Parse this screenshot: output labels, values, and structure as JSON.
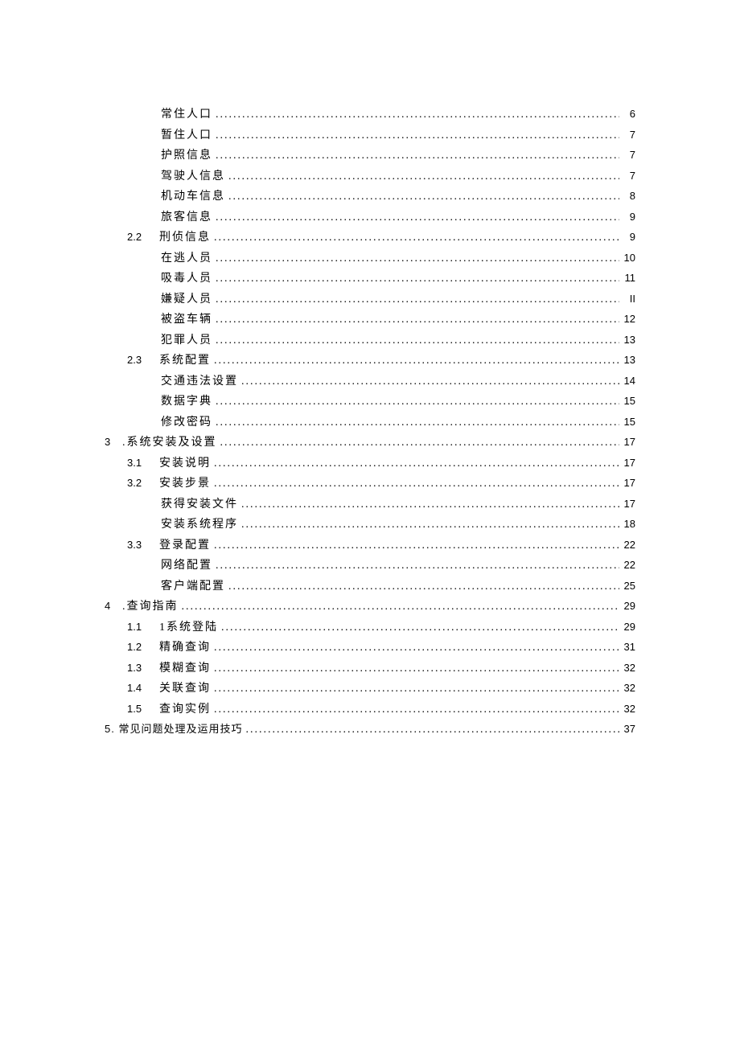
{
  "toc": [
    {
      "level": 2,
      "num": "",
      "title": "常住人口",
      "page": "6"
    },
    {
      "level": 2,
      "num": "",
      "title": "暂住人口",
      "page": "7"
    },
    {
      "level": 2,
      "num": "",
      "title": "护照信息",
      "page": "7"
    },
    {
      "level": 2,
      "num": "",
      "title": "驾驶人信息",
      "page": "7"
    },
    {
      "level": 2,
      "num": "",
      "title": "机动车信息",
      "page": "8"
    },
    {
      "level": 2,
      "num": "",
      "title": "旅客信息",
      "page": "9"
    },
    {
      "level": 1,
      "num": "2.2",
      "title": "刑侦信息",
      "page": "9"
    },
    {
      "level": 2,
      "num": "",
      "title": "在逃人员",
      "page": "10"
    },
    {
      "level": 2,
      "num": "",
      "title": "吸毒人员",
      "page": "11"
    },
    {
      "level": 2,
      "num": "",
      "title": "嫌疑人员",
      "page": "II"
    },
    {
      "level": 2,
      "num": "",
      "title": "被盗车辆",
      "page": "12"
    },
    {
      "level": 2,
      "num": "",
      "title": "犯罪人员",
      "page": "13"
    },
    {
      "level": 1,
      "num": "2.3",
      "title": "系统配置",
      "page": "13"
    },
    {
      "level": 2,
      "num": "",
      "title": "交通违法设置",
      "page": "14"
    },
    {
      "level": 2,
      "num": "",
      "title": "数据字典",
      "page": "15"
    },
    {
      "level": 2,
      "num": "",
      "title": "修改密码",
      "page": "15"
    },
    {
      "level": 0,
      "num": "3",
      "title": ".系统安装及设置",
      "page": "17"
    },
    {
      "level": 1,
      "num": "3.1",
      "title": "安装说明",
      "page": "17"
    },
    {
      "level": 1,
      "num": "3.2",
      "title": "安装步景",
      "page": "17"
    },
    {
      "level": 2,
      "num": "",
      "title": "获得安装文件",
      "page": "17"
    },
    {
      "level": 2,
      "num": "",
      "title": "安装系统程序",
      "page": "18"
    },
    {
      "level": 1,
      "num": "3.3",
      "title": "登录配置",
      "page": "22"
    },
    {
      "level": 2,
      "num": "",
      "title": "网络配置",
      "page": "22"
    },
    {
      "level": 2,
      "num": "",
      "title": "客户端配置",
      "page": "25"
    },
    {
      "level": 0,
      "num": "4",
      "title": ".查询指南",
      "page": "29"
    },
    {
      "level": 1,
      "num": "1.1",
      "title": "1系统登陆",
      "page": "29"
    },
    {
      "level": 1,
      "num": "1.2",
      "title": "精确查询",
      "page": "31"
    },
    {
      "level": 1,
      "num": "1.3",
      "title": "模糊查询",
      "page": "32"
    },
    {
      "level": 1,
      "num": "1.4",
      "title": "关联查询",
      "page": "32"
    },
    {
      "level": 1,
      "num": "1.5",
      "title": "查询实例",
      "page": "32"
    }
  ],
  "special_row": {
    "title": "5. 常见问题处理及运用技巧",
    "page": "37"
  }
}
